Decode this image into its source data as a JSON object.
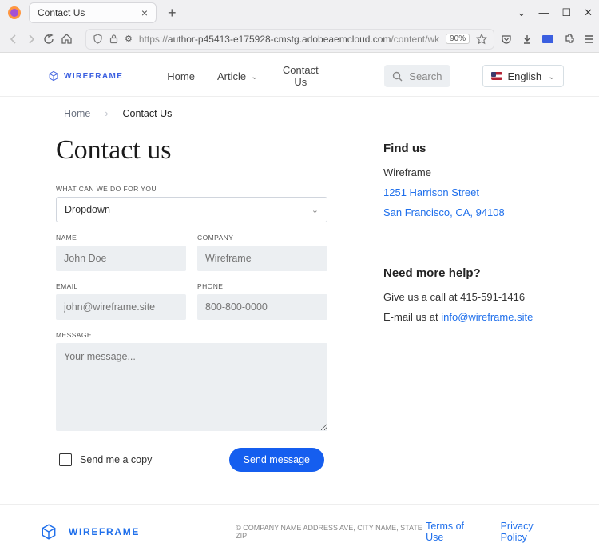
{
  "browser": {
    "tab_title": "Contact Us",
    "url_prefix": "https://",
    "url_host": "author-p45413-e175928-cmstg.adobeaemcloud.com",
    "url_path": "/content/wk",
    "zoom": "90%"
  },
  "header": {
    "brand": "WIREFRAME",
    "nav": {
      "home": "Home",
      "article": "Article",
      "contact": "Contact Us"
    },
    "search_placeholder": "Search",
    "language": "English"
  },
  "breadcrumb": {
    "home": "Home",
    "current": "Contact Us"
  },
  "page": {
    "title": "Contact us",
    "labels": {
      "what": "WHAT CAN WE DO FOR YOU",
      "name": "NAME",
      "company": "COMPANY",
      "email": "EMAIL",
      "phone": "PHONE",
      "message": "MESSAGE"
    },
    "dropdown": "Dropdown",
    "placeholders": {
      "name": "John Doe",
      "company": "Wireframe",
      "email": "john@wireframe.site",
      "phone": "800-800-0000",
      "message": "Your message..."
    },
    "copy_label": "Send me a copy",
    "send_label": "Send message"
  },
  "sidebar": {
    "find_title": "Find us",
    "company": "Wireframe",
    "address1": "1251 Harrison Street",
    "address2": "San Francisco, CA, 94108",
    "help_title": "Need more help?",
    "call_prefix": "Give us a call at ",
    "phone": "415-591-1416",
    "email_prefix": "E-mail us at ",
    "email": "info@wireframe.site"
  },
  "footer": {
    "brand": "WIREFRAME",
    "copyright": "© COMPANY NAME ADDRESS AVE, CITY NAME, STATE ZIP",
    "terms": "Terms of Use",
    "privacy": "Privacy Policy"
  }
}
